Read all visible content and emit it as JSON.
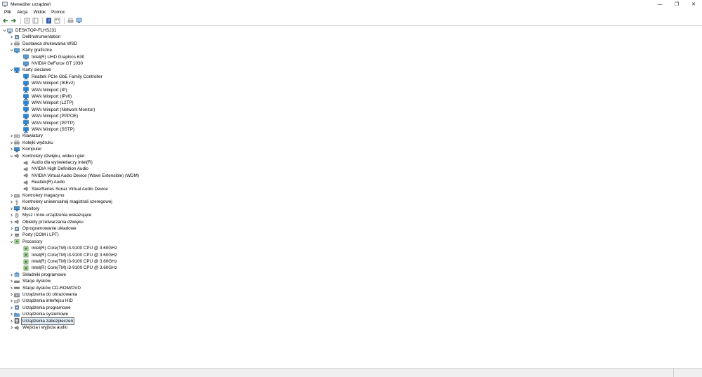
{
  "window": {
    "title": "Menedżer urządzeń",
    "controls": {
      "minimize": "—",
      "maximize": "❐",
      "close": "✕"
    }
  },
  "menu": [
    "Plik",
    "Akcja",
    "Widok",
    "Pomoc"
  ],
  "toolbar": [
    "back-icon",
    "forward-icon",
    "properties-view-icon",
    "console-tree-icon",
    "help-icon",
    "details-icon",
    "print-icon",
    "monitor-icon"
  ],
  "tree": [
    {
      "label": "DESKTOP-FLHSJ31",
      "level": 0,
      "state": "expanded",
      "icon": "computer"
    },
    {
      "label": "DellInstrumentation",
      "level": 1,
      "state": "collapsed",
      "icon": "chip"
    },
    {
      "label": "Dostawca drukowania WSD",
      "level": 1,
      "state": "collapsed",
      "icon": "printer"
    },
    {
      "label": "Karty graficzne",
      "level": 1,
      "state": "expanded",
      "icon": "display"
    },
    {
      "label": "Intel(R) UHD Graphics 630",
      "level": 2,
      "state": "leaf",
      "icon": "display"
    },
    {
      "label": "NVIDIA GeForce GT 1030",
      "level": 2,
      "state": "leaf",
      "icon": "display"
    },
    {
      "label": "Karty sieciowe",
      "level": 1,
      "state": "expanded",
      "icon": "network"
    },
    {
      "label": "Realtek PCIe GbE Family Controller",
      "level": 2,
      "state": "leaf",
      "icon": "network"
    },
    {
      "label": "WAN Miniport (IKEv2)",
      "level": 2,
      "state": "leaf",
      "icon": "network"
    },
    {
      "label": "WAN Miniport (IP)",
      "level": 2,
      "state": "leaf",
      "icon": "network"
    },
    {
      "label": "WAN Miniport (IPv6)",
      "level": 2,
      "state": "leaf",
      "icon": "network"
    },
    {
      "label": "WAN Miniport (L2TP)",
      "level": 2,
      "state": "leaf",
      "icon": "network"
    },
    {
      "label": "WAN Miniport (Network Monitor)",
      "level": 2,
      "state": "leaf",
      "icon": "network"
    },
    {
      "label": "WAN Miniport (PPPOE)",
      "level": 2,
      "state": "leaf",
      "icon": "network"
    },
    {
      "label": "WAN Miniport (PPTP)",
      "level": 2,
      "state": "leaf",
      "icon": "network"
    },
    {
      "label": "WAN Miniport (SSTP)",
      "level": 2,
      "state": "leaf",
      "icon": "network"
    },
    {
      "label": "Klawiatury",
      "level": 1,
      "state": "collapsed",
      "icon": "keyboard"
    },
    {
      "label": "Kolejki wydruku",
      "level": 1,
      "state": "collapsed",
      "icon": "printer"
    },
    {
      "label": "Komputer",
      "level": 1,
      "state": "collapsed",
      "icon": "monitor"
    },
    {
      "label": "Kontrolery dźwięku, wideo i gier",
      "level": 1,
      "state": "expanded",
      "icon": "speaker"
    },
    {
      "label": "Audio dla wyświetlaczy Intel(R)",
      "level": 2,
      "state": "leaf",
      "icon": "speaker"
    },
    {
      "label": "NVIDIA High Definition Audio",
      "level": 2,
      "state": "leaf",
      "icon": "speaker"
    },
    {
      "label": "NVIDIA Virtual Audio Device (Wave Extensible) (WDM)",
      "level": 2,
      "state": "leaf",
      "icon": "speaker"
    },
    {
      "label": "Realtek(R) Audio",
      "level": 2,
      "state": "leaf",
      "icon": "speaker"
    },
    {
      "label": "SteelSeries Sonar Virtual Audio Device",
      "level": 2,
      "state": "leaf",
      "icon": "speaker"
    },
    {
      "label": "Kontrolery magazynu",
      "level": 1,
      "state": "collapsed",
      "icon": "storage"
    },
    {
      "label": "Kontrolery uniwersalnej magistrali szeregowej",
      "level": 1,
      "state": "collapsed",
      "icon": "usb"
    },
    {
      "label": "Monitory",
      "level": 1,
      "state": "collapsed",
      "icon": "monitor"
    },
    {
      "label": "Mysz i inne urządzenia wskazujące",
      "level": 1,
      "state": "collapsed",
      "icon": "mouse"
    },
    {
      "label": "Obiekty przetwarzania dźwięku",
      "level": 1,
      "state": "collapsed",
      "icon": "speaker"
    },
    {
      "label": "Oprogramowanie układowe",
      "level": 1,
      "state": "collapsed",
      "icon": "chip"
    },
    {
      "label": "Porty (COM i LPT)",
      "level": 1,
      "state": "collapsed",
      "icon": "port"
    },
    {
      "label": "Procesory",
      "level": 1,
      "state": "expanded",
      "icon": "cpu"
    },
    {
      "label": "Intel(R) Core(TM) i3-9100 CPU @ 3.60GHz",
      "level": 2,
      "state": "leaf",
      "icon": "cpu"
    },
    {
      "label": "Intel(R) Core(TM) i3-9100 CPU @ 3.60GHz",
      "level": 2,
      "state": "leaf",
      "icon": "cpu"
    },
    {
      "label": "Intel(R) Core(TM) i3-9100 CPU @ 3.60GHz",
      "level": 2,
      "state": "leaf",
      "icon": "cpu"
    },
    {
      "label": "Intel(R) Core(TM) i3-9100 CPU @ 3.60GHz",
      "level": 2,
      "state": "leaf",
      "icon": "cpu"
    },
    {
      "label": "Składniki programowe",
      "level": 1,
      "state": "collapsed",
      "icon": "puzzle"
    },
    {
      "label": "Stacje dysków",
      "level": 1,
      "state": "collapsed",
      "icon": "disk"
    },
    {
      "label": "Stacje dysków CD-ROM/DVD",
      "level": 1,
      "state": "collapsed",
      "icon": "disk"
    },
    {
      "label": "Urządzenia do obrazowania",
      "level": 1,
      "state": "collapsed",
      "icon": "camera"
    },
    {
      "label": "Urządzenia interfejsu HID",
      "level": 1,
      "state": "collapsed",
      "icon": "hid"
    },
    {
      "label": "Urządzenia programowe",
      "level": 1,
      "state": "collapsed",
      "icon": "chip"
    },
    {
      "label": "Urządzenia systemowe",
      "level": 1,
      "state": "collapsed",
      "icon": "folder"
    },
    {
      "label": "Urządzenia zabezpieczeń",
      "level": 1,
      "state": "collapsed",
      "icon": "security",
      "selected": true
    },
    {
      "label": "Wejścia i wyjścia audio",
      "level": 1,
      "state": "collapsed",
      "icon": "speaker"
    }
  ],
  "colors": {
    "selection_bg": "#e5f1fb",
    "network_icon": "#2b88d8",
    "cpu_icon": "#3a7d2c"
  }
}
